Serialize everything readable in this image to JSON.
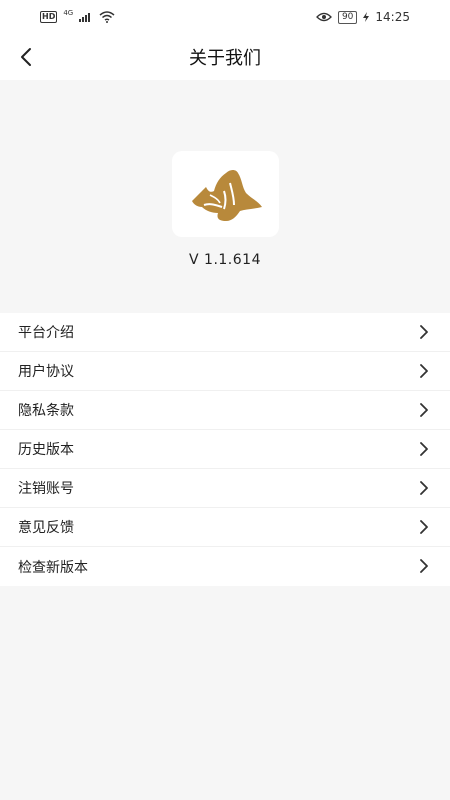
{
  "status_bar": {
    "hd": "HD",
    "network": "4G",
    "battery": "90",
    "time": "14:25",
    "icons": [
      "signal-icon",
      "wifi-icon",
      "eye-icon",
      "battery-icon",
      "charging-icon"
    ]
  },
  "header": {
    "title": "关于我们",
    "back_icon": "chevron-left-icon"
  },
  "app": {
    "logo": "mountain-logo",
    "logo_color": "#B8893B",
    "version": "V 1.1.614"
  },
  "menu": {
    "items": [
      {
        "label": "平台介绍"
      },
      {
        "label": "用户协议"
      },
      {
        "label": "隐私条款"
      },
      {
        "label": "历史版本"
      },
      {
        "label": "注销账号"
      },
      {
        "label": "意见反馈"
      },
      {
        "label": "检查新版本"
      }
    ],
    "chevron_icon": "chevron-right-icon"
  }
}
